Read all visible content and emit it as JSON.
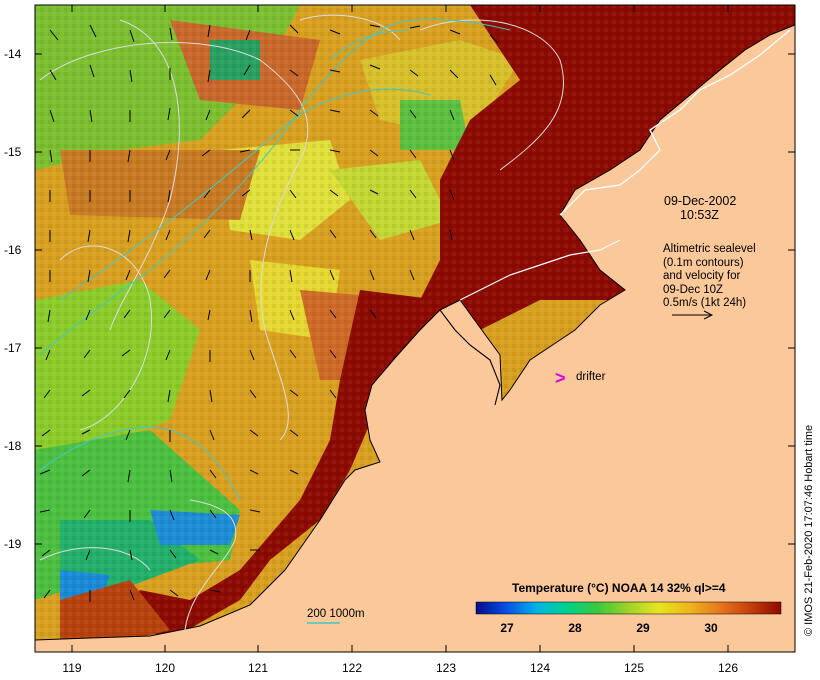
{
  "map": {
    "date": "09-Dec-2002",
    "time": "10:53Z",
    "altimetry_lines": [
      "Altimetric sealevel",
      "(0.1m contours)",
      "and velocity for",
      "09-Dec 10Z",
      "0.5m/s (1kt 24h)"
    ],
    "drifter_symbol": ">",
    "drifter_label": "drifter",
    "depth_legend": {
      "values": "200  1000m"
    },
    "colorbar": {
      "title": "Temperature (°C) NOAA 14 32% ql>=4",
      "ticks": [
        "27",
        "28",
        "29",
        "30"
      ],
      "colors": [
        "#0a0a8c",
        "#0050e6",
        "#00b4e6",
        "#00d28c",
        "#3cc83c",
        "#a0d228",
        "#e6e61e",
        "#f0b41e",
        "#e6781e",
        "#c83c0a",
        "#8c0a00"
      ]
    },
    "credit": "© IMOS 21-Feb-2020 17:07:46 Hobart time",
    "y_axis": {
      "labels": [
        "-14",
        "-15",
        "-16",
        "-17",
        "-18",
        "-19"
      ]
    },
    "x_axis": {
      "labels": [
        "119",
        "120",
        "121",
        "122",
        "123",
        "124",
        "125",
        "126"
      ]
    },
    "colors": {
      "land": "#fbc89a",
      "warm": "#8c0a00",
      "drifter": "#e000e0",
      "contour": "#dcdcdc",
      "depth_line": "#40c8c8"
    }
  }
}
